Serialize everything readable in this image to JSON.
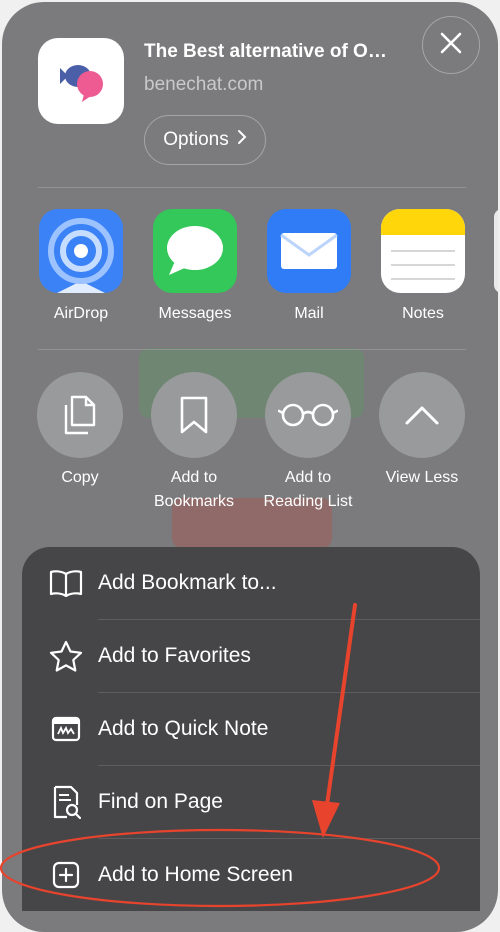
{
  "header": {
    "title": "The Best alternative of O…",
    "domain": "benechat.com",
    "options_label": "Options",
    "app_icon": "benechat-logo"
  },
  "share_apps": [
    {
      "label": "AirDrop",
      "icon": "airdrop-icon",
      "color": "#3b82f6"
    },
    {
      "label": "Messages",
      "icon": "messages-icon",
      "color": "#34c759"
    },
    {
      "label": "Mail",
      "icon": "mail-icon",
      "color": "#2f7cf6"
    },
    {
      "label": "Notes",
      "icon": "notes-icon",
      "color": "#ffd60a"
    }
  ],
  "actions": [
    {
      "label": "Copy",
      "icon": "copy-icon"
    },
    {
      "label": "Add to Bookmarks",
      "icon": "bookmark-icon"
    },
    {
      "label": "Add to Reading List",
      "icon": "glasses-icon"
    },
    {
      "label": "View Less",
      "icon": "chevron-up-icon"
    }
  ],
  "menu": [
    {
      "label": "Add Bookmark to...",
      "icon": "book-icon"
    },
    {
      "label": "Add to Favorites",
      "icon": "star-icon"
    },
    {
      "label": "Add to Quick Note",
      "icon": "quick-note-icon"
    },
    {
      "label": "Find on Page",
      "icon": "find-on-page-icon"
    },
    {
      "label": "Add to Home Screen",
      "icon": "add-square-icon"
    }
  ],
  "annotation": {
    "color": "#e8432d"
  }
}
